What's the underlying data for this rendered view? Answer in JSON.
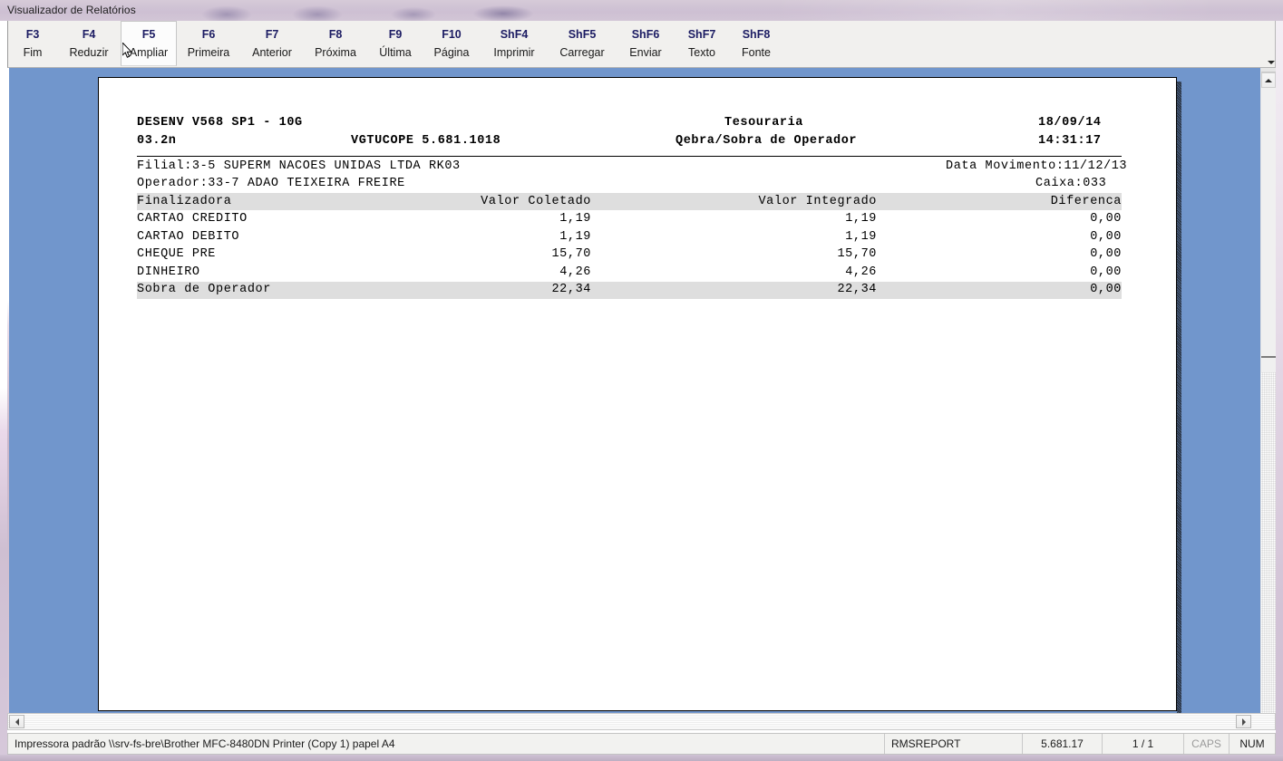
{
  "window": {
    "title": "Visualizador de Relatórios"
  },
  "toolbar": {
    "buttons": [
      {
        "key": "F3",
        "label": "Fim",
        "active": false
      },
      {
        "key": "F4",
        "label": "Reduzir",
        "active": false
      },
      {
        "key": "F5",
        "label": "Ampliar",
        "active": true
      },
      {
        "key": "F6",
        "label": "Primeira",
        "active": false
      },
      {
        "key": "F7",
        "label": "Anterior",
        "active": false
      },
      {
        "key": "F8",
        "label": "Próxima",
        "active": false
      },
      {
        "key": "F9",
        "label": "Última",
        "active": false
      },
      {
        "key": "F10",
        "label": "Página",
        "active": false
      },
      {
        "key": "ShF4",
        "label": "Imprimir",
        "active": false
      },
      {
        "key": "ShF5",
        "label": "Carregar",
        "active": false
      },
      {
        "key": "ShF6",
        "label": "Enviar",
        "active": false
      },
      {
        "key": "ShF7",
        "label": "Texto",
        "active": false
      },
      {
        "key": "ShF8",
        "label": "Fonte",
        "active": false
      }
    ]
  },
  "report": {
    "header": {
      "system_line1": "DESENV V568 SP1 - 10G",
      "system_line2": "03.2n",
      "program_code": "VGTUCOPE 5.681.1018",
      "title_line1": "Tesouraria",
      "title_line2": "Qebra/Sobra de Operador",
      "date": "18/09/14",
      "time": "14:31:17"
    },
    "subheader": {
      "filial": "Filial:3-5 SUPERM NACOES UNIDAS LTDA RK03",
      "operador": "Operador:33-7 ADAO TEIXEIRA FREIRE",
      "data_movimento": "Data Movimento:11/12/13",
      "caixa": "Caixa:033"
    },
    "table": {
      "columns": [
        "Finalizadora",
        "Valor Coletado",
        "Valor Integrado",
        "Diferenca"
      ],
      "rows": [
        {
          "finalizadora": "CARTAO CREDITO",
          "coletado": "1,19",
          "integrado": "1,19",
          "diferenca": "0,00"
        },
        {
          "finalizadora": "CARTAO DEBITO",
          "coletado": "1,19",
          "integrado": "1,19",
          "diferenca": "0,00"
        },
        {
          "finalizadora": "CHEQUE PRE",
          "coletado": "15,70",
          "integrado": "15,70",
          "diferenca": "0,00"
        },
        {
          "finalizadora": "DINHEIRO",
          "coletado": "4,26",
          "integrado": "4,26",
          "diferenca": "0,00"
        }
      ],
      "total": {
        "finalizadora": "Sobra de Operador",
        "coletado": "22,34",
        "integrado": "22,34",
        "diferenca": "0,00"
      }
    }
  },
  "statusbar": {
    "printer": "Impressora padrão \\\\srv-fs-bre\\Brother MFC-8480DN Printer (Copy 1) papel A4",
    "module": "RMSREPORT",
    "version": "5.681.17",
    "pages": "1 / 1",
    "caps": "CAPS",
    "num": "NUM"
  },
  "colors": {
    "viewport_background": "#7196cc",
    "band_gray": "#dedede",
    "toolbar_key": "#1c1c63"
  }
}
